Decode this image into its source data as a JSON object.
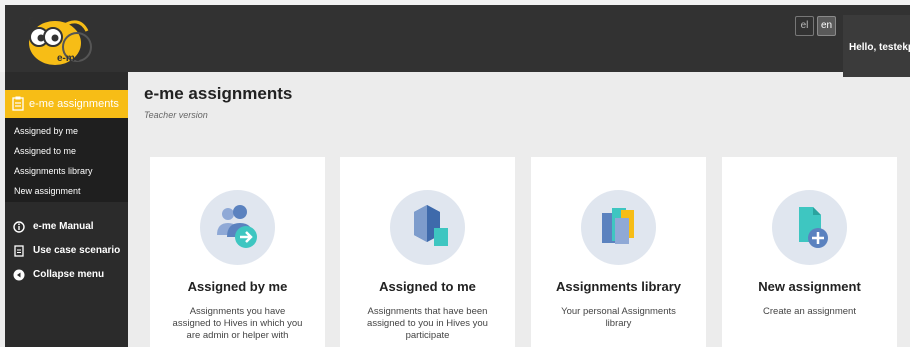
{
  "header": {
    "logo_text": "e-me",
    "languages": [
      "el",
      "en"
    ],
    "greeting": "Hello, testekp"
  },
  "sidebar": {
    "active_label": "e-me assignments",
    "submenu": [
      "Assigned by me",
      "Assigned to me",
      "Assignments library",
      "New assignment"
    ],
    "items": [
      "e-me Manual",
      "Use case scenario",
      "Collapse menu"
    ]
  },
  "page": {
    "title": "e-me assignments",
    "subtitle": "Teacher version"
  },
  "cards": [
    {
      "title": "Assigned by me",
      "desc": "Assignments you have assigned to Hives in which you are admin or helper with"
    },
    {
      "title": "Assigned to me",
      "desc": "Assignments that have been assigned to you in Hives you participate"
    },
    {
      "title": "Assignments library",
      "desc": "Your personal Assignments library"
    },
    {
      "title": "New assignment",
      "desc": "Create an assignment"
    }
  ],
  "colors": {
    "accent": "#f7bd16",
    "topbar": "#323232",
    "sidebar": "#2b2b2b",
    "icon_blue": "#5b82bf",
    "icon_teal": "#3ec6c1"
  }
}
